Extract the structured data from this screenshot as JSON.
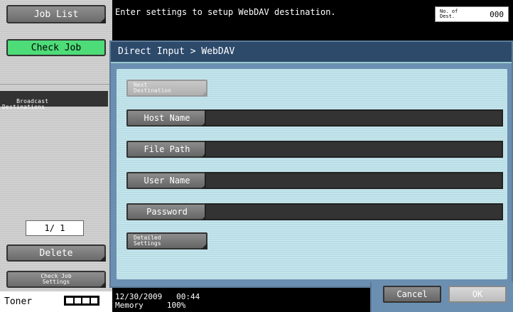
{
  "left_panel": {
    "job_list_label": "Job List",
    "check_job_label": "Check Job",
    "broadcast_header": "Broadcast\nDestinations",
    "pager": "1/ 1",
    "delete_label": "Delete",
    "check_job_settings_label": "Check Job\nSettings",
    "toner_label": "Toner"
  },
  "header": {
    "message": "Enter settings to setup WebDAV destination.",
    "dest_count_label": "No. of\nDest.",
    "dest_count_value": "000"
  },
  "panel": {
    "title": "Direct Input > WebDAV",
    "next_destination_label": "Next\nDestination",
    "fields": [
      {
        "label": "Host Name",
        "value": ""
      },
      {
        "label": "File Path",
        "value": ""
      },
      {
        "label": "User Name",
        "value": ""
      },
      {
        "label": "Password",
        "value": ""
      }
    ],
    "detailed_settings_label": "Detailed\nSettings"
  },
  "footer": {
    "date": "12/30/2009",
    "time": "00:44",
    "memory_label": "Memory",
    "memory_value": "100%",
    "cancel_label": "Cancel",
    "ok_label": "OK"
  },
  "colors": {
    "panel_bg": "#6b8fb0",
    "title_bg": "#2d4a6b",
    "check_job_green": "#4ddc78"
  }
}
